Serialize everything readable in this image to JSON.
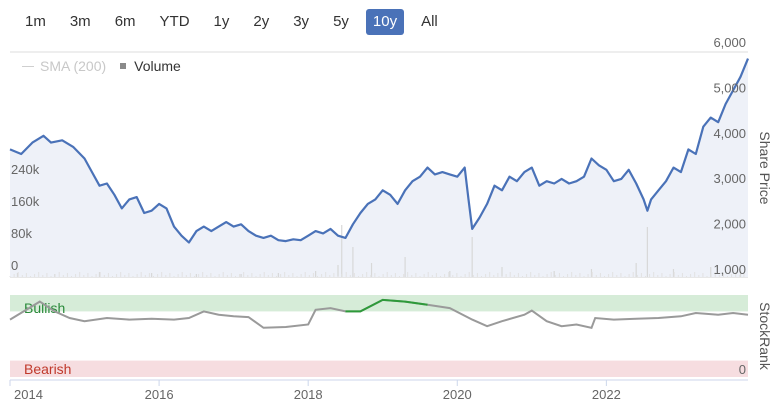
{
  "range_buttons": [
    "1m",
    "3m",
    "6m",
    "YTD",
    "1y",
    "2y",
    "3y",
    "5y",
    "10y",
    "All"
  ],
  "active_range": "10y",
  "legend": {
    "sma": "SMA (200)",
    "volume": "Volume"
  },
  "colors": {
    "price": "#4a72b8",
    "stockrank": "#9a9a9a",
    "stockrank_bullish": "#2e9a3a",
    "bullish_band": "#d6ecd8",
    "bearish_band": "#f6dde0",
    "active_button": "#4a72b8"
  },
  "chart_data": [
    {
      "type": "line",
      "x_tick_labels": [
        "2014",
        "2016",
        "2018",
        "2020",
        "2022"
      ],
      "xlim": [
        2014,
        2023.9
      ],
      "series": [
        {
          "values": [
            [
              2014.0,
              3700
            ],
            [
              2014.15,
              3600
            ],
            [
              2014.3,
              3850
            ],
            [
              2014.45,
              4000
            ],
            [
              2014.55,
              3850
            ],
            [
              2014.7,
              3900
            ],
            [
              2014.85,
              3750
            ],
            [
              2015.0,
              3500
            ],
            [
              2015.1,
              3200
            ],
            [
              2015.2,
              2900
            ],
            [
              2015.3,
              2950
            ],
            [
              2015.4,
              2700
            ],
            [
              2015.5,
              2400
            ],
            [
              2015.6,
              2600
            ],
            [
              2015.7,
              2650
            ],
            [
              2015.8,
              2300
            ],
            [
              2015.9,
              2350
            ],
            [
              2016.0,
              2500
            ],
            [
              2016.1,
              2400
            ],
            [
              2016.2,
              2000
            ],
            [
              2016.3,
              1800
            ],
            [
              2016.4,
              1650
            ],
            [
              2016.5,
              1900
            ],
            [
              2016.6,
              2000
            ],
            [
              2016.7,
              1900
            ],
            [
              2016.8,
              2000
            ],
            [
              2016.9,
              2100
            ],
            [
              2017.0,
              2000
            ],
            [
              2017.1,
              2050
            ],
            [
              2017.2,
              1900
            ],
            [
              2017.3,
              1800
            ],
            [
              2017.4,
              1750
            ],
            [
              2017.5,
              1800
            ],
            [
              2017.6,
              1700
            ],
            [
              2017.7,
              1680
            ],
            [
              2017.8,
              1720
            ],
            [
              2017.9,
              1700
            ],
            [
              2018.0,
              1800
            ],
            [
              2018.1,
              1900
            ],
            [
              2018.2,
              1850
            ],
            [
              2018.3,
              1950
            ],
            [
              2018.4,
              1800
            ],
            [
              2018.5,
              1750
            ],
            [
              2018.6,
              2050
            ],
            [
              2018.7,
              2300
            ],
            [
              2018.8,
              2500
            ],
            [
              2018.9,
              2600
            ],
            [
              2019.0,
              2800
            ],
            [
              2019.1,
              2700
            ],
            [
              2019.2,
              2500
            ],
            [
              2019.3,
              2800
            ],
            [
              2019.4,
              3000
            ],
            [
              2019.5,
              3100
            ],
            [
              2019.6,
              3300
            ],
            [
              2019.7,
              3150
            ],
            [
              2019.8,
              3200
            ],
            [
              2019.9,
              3150
            ],
            [
              2020.0,
              3100
            ],
            [
              2020.1,
              3300
            ],
            [
              2020.15,
              2600
            ],
            [
              2020.2,
              1950
            ],
            [
              2020.3,
              2200
            ],
            [
              2020.4,
              2500
            ],
            [
              2020.5,
              2900
            ],
            [
              2020.6,
              2800
            ],
            [
              2020.7,
              3100
            ],
            [
              2020.8,
              3000
            ],
            [
              2020.9,
              3200
            ],
            [
              2021.0,
              3300
            ],
            [
              2021.1,
              2900
            ],
            [
              2021.2,
              3000
            ],
            [
              2021.3,
              2950
            ],
            [
              2021.4,
              3050
            ],
            [
              2021.5,
              2950
            ],
            [
              2021.6,
              3000
            ],
            [
              2021.7,
              3100
            ],
            [
              2021.8,
              3500
            ],
            [
              2021.9,
              3350
            ],
            [
              2022.0,
              3250
            ],
            [
              2022.1,
              3000
            ],
            [
              2022.2,
              3050
            ],
            [
              2022.3,
              3250
            ],
            [
              2022.4,
              2950
            ],
            [
              2022.5,
              2600
            ],
            [
              2022.55,
              2350
            ],
            [
              2022.6,
              2600
            ],
            [
              2022.7,
              2800
            ],
            [
              2022.8,
              3000
            ],
            [
              2022.9,
              3300
            ],
            [
              2023.0,
              3200
            ],
            [
              2023.1,
              3700
            ],
            [
              2023.2,
              3600
            ],
            [
              2023.3,
              4200
            ],
            [
              2023.4,
              4400
            ],
            [
              2023.5,
              4300
            ],
            [
              2023.6,
              4700
            ],
            [
              2023.7,
              5000
            ],
            [
              2023.8,
              5300
            ],
            [
              2023.9,
              5700
            ]
          ]
        }
      ],
      "volume_y_labels": [
        "0",
        "80k",
        "160k",
        "240k"
      ],
      "price_y_labels": [
        "1,000",
        "2,000",
        "3,000",
        "4,000",
        "5,000",
        "6,000"
      ],
      "price_axis_title": "Share Price"
    },
    {
      "type": "line",
      "band_labels": {
        "bullish": "Bullish",
        "bearish": "Bearish"
      },
      "y_label": "0",
      "axis_title": "StockRank",
      "xlim": [
        2014,
        2023.9
      ],
      "series": [
        {
          "values": [
            [
              2014.0,
              70
            ],
            [
              2014.4,
              92
            ],
            [
              2014.6,
              80
            ],
            [
              2014.8,
              72
            ],
            [
              2015.0,
              68
            ],
            [
              2015.3,
              72
            ],
            [
              2015.6,
              70
            ],
            [
              2015.9,
              71
            ],
            [
              2016.2,
              70
            ],
            [
              2016.4,
              72
            ],
            [
              2016.6,
              80
            ],
            [
              2016.8,
              76
            ],
            [
              2017.0,
              74
            ],
            [
              2017.2,
              73
            ],
            [
              2017.4,
              60
            ],
            [
              2017.7,
              61
            ],
            [
              2018.0,
              64
            ],
            [
              2018.1,
              82
            ],
            [
              2018.3,
              84
            ],
            [
              2018.5,
              80
            ],
            [
              2018.7,
              80
            ],
            [
              2019.0,
              94
            ],
            [
              2019.3,
              92
            ],
            [
              2019.6,
              88
            ],
            [
              2019.9,
              84
            ],
            [
              2020.2,
              70
            ],
            [
              2020.4,
              62
            ],
            [
              2020.6,
              68
            ],
            [
              2020.9,
              76
            ],
            [
              2021.0,
              81
            ],
            [
              2021.2,
              68
            ],
            [
              2021.4,
              62
            ],
            [
              2021.6,
              64
            ],
            [
              2021.8,
              60
            ],
            [
              2021.85,
              72
            ],
            [
              2022.1,
              70
            ],
            [
              2022.4,
              71
            ],
            [
              2022.7,
              72
            ],
            [
              2023.0,
              74
            ],
            [
              2023.2,
              78
            ],
            [
              2023.5,
              76
            ],
            [
              2023.7,
              78
            ],
            [
              2023.9,
              76
            ]
          ]
        }
      ]
    }
  ]
}
